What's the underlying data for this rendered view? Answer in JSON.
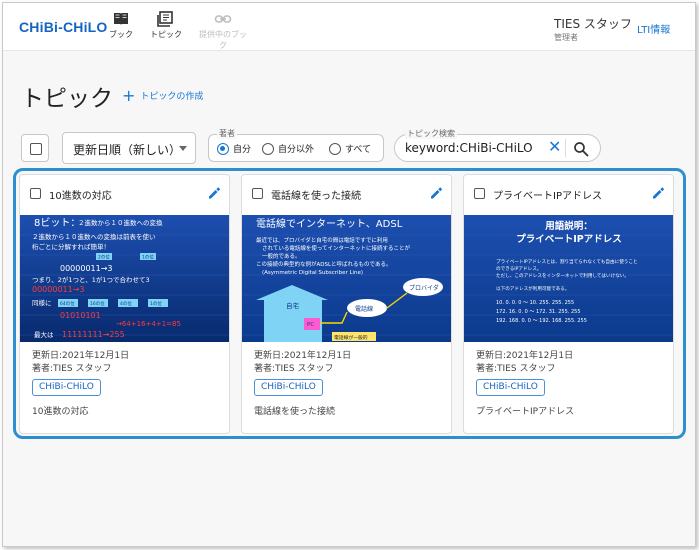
{
  "header": {
    "logo": "CHiBi-CHiLO",
    "nav": [
      {
        "label": "ブック",
        "icon": "book-icon"
      },
      {
        "label": "トピック",
        "icon": "topic-icon"
      },
      {
        "label": "提供中のブック",
        "icon": "link-icon"
      }
    ],
    "user_name": "TIES スタッフ",
    "user_role": "管理者",
    "lti_link": "LTI情報"
  },
  "page": {
    "title": "トピック",
    "create_label": "トピックの作成"
  },
  "controls": {
    "sort_value": "更新日順（新しい）",
    "author_legend": "著者",
    "author_options": [
      "自分",
      "自分以外",
      "すべて"
    ],
    "author_selected": "自分",
    "search_legend": "トピック検索",
    "search_value": "keyword:CHiBi-CHiLO"
  },
  "colors": {
    "accent": "#1976d2",
    "highlight": "#2d8fd0",
    "slide_bg": "#0b3a8c"
  },
  "cards": [
    {
      "title": "10進数の対応",
      "updated": "更新日:2021年12月1日",
      "author": "著者:TIES スタッフ",
      "keyword": "CHiBi-CHiLO",
      "description": "10進数の対応",
      "thumb": {
        "heading": "8ビット：",
        "heading2": "２進数から１０進数への変換",
        "lines": [
          "２進数から１０進数への変換は前表を使い",
          "桁ごとに分解すれば簡単！"
        ],
        "digits": "00000011→3",
        "line2": "つまり、2が1つと、1が1つで合わせて3",
        "red1": "00000011→3",
        "label_same": "同様に",
        "bins": "01010101",
        "calc": "→64+16+4+1=85",
        "max_label": "最大は",
        "max": "11111111→255",
        "tags": [
          "2の位",
          "1の位",
          "64の位",
          "16の位",
          "4の位",
          "1の位"
        ]
      }
    },
    {
      "title": "電話線を使った接続",
      "updated": "更新日:2021年12月1日",
      "author": "著者:TIES スタッフ",
      "keyword": "CHiBi-CHiLO",
      "description": "電話線を使った接続",
      "thumb": {
        "heading": "電話線でインターネット、ADSL",
        "bullets": [
          "最近では、プロバイダと自宅の間は電話ですでに利用",
          "されている電話線を使ってインターネットに接続することが",
          "一般的である。",
          "この接続の典型的な例がADSLと呼ばれるものである。",
          "(Asymmetric Digital Subscriber Line)"
        ],
        "house": "自宅",
        "pc": "PC",
        "phone_line": "電話線",
        "provider": "プロバイダ",
        "shared": "電話線が一般的"
      }
    },
    {
      "title": "プライベートIPアドレス",
      "updated": "更新日:2021年12月1日",
      "author": "著者:TIES スタッフ",
      "keyword": "CHiBi-CHiLO",
      "description": "プライベートIPアドレス",
      "thumb": {
        "heading": "用語説明：",
        "heading2": "プライベートIPアドレス",
        "lines": [
          "プライベートIPアドレスとは、割り当てられなくても自由に使うこと",
          "のできるIPアドレス。",
          "ただし、このアドレスをインターネットで利用してはいけない。",
          "以下のアドレスが利用可能である。"
        ],
        "ranges": [
          "10. 0. 0. 0 ～ 10. 255. 255. 255",
          "172. 16. 0. 0 ～ 172. 31. 255. 255",
          "192. 168. 0. 0 ～ 192. 168. 255. 255"
        ]
      }
    }
  ]
}
